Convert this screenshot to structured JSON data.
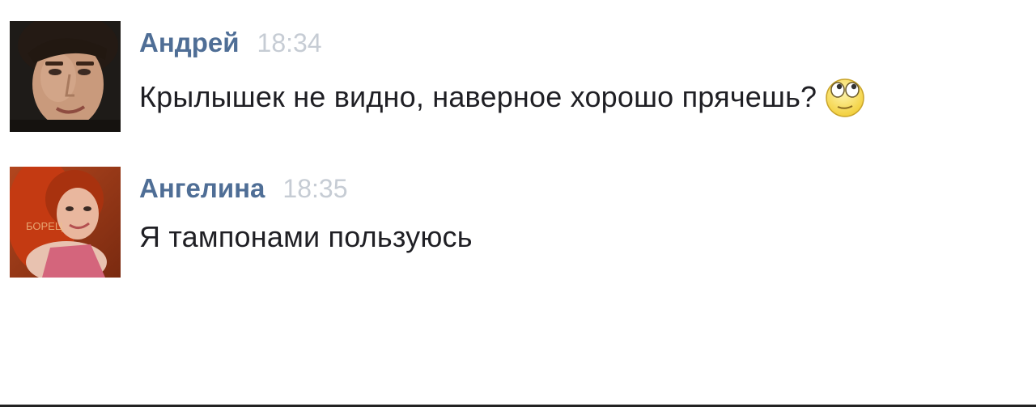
{
  "messages": [
    {
      "author": "Андрей",
      "time": "18:34",
      "text": "Крылышек не видно, наверное хорошо прячешь?",
      "emoji": "rolling-eyes-emoji"
    },
    {
      "author": "Ангелина",
      "time": "18:35",
      "text": "Я тампонами пользуюсь",
      "avatar_watermark": "БОРЕЦ"
    }
  ],
  "colors": {
    "author": "#4f6e96",
    "time": "#c6ccd4",
    "text": "#1f1f24",
    "background": "#ffffff"
  }
}
